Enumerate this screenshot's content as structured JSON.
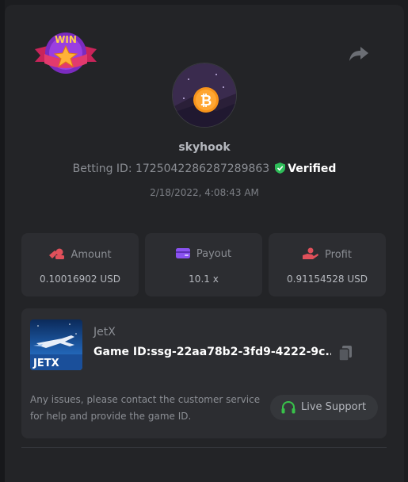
{
  "colors": {
    "page_bg": "#1c1d20",
    "modal_bg": "#232427",
    "card_bg": "#2c2d31",
    "verified_green": "#2ebd59",
    "amount_red": "#e0505a",
    "payout_purple": "#8a52f0",
    "profit_red": "#e0505a",
    "support_green": "#38c24a"
  },
  "badge": {
    "text": "WIN"
  },
  "user": {
    "name": "skyhook",
    "betting_id_label": "Betting ID: 1725042286287289863",
    "verified_label": "Verified",
    "date": "2/18/2022, 4:08:43 AM"
  },
  "stats": [
    {
      "label": "Amount",
      "value": "0.10016902 USD",
      "icon": "coins-icon"
    },
    {
      "label": "Payout",
      "value": "10.1 x",
      "icon": "wallet-icon"
    },
    {
      "label": "Profit",
      "value": "0.91154528 USD",
      "icon": "profit-hand-icon"
    }
  ],
  "game": {
    "name": "JetX",
    "thumb_label": "JETX",
    "id_label": "Game ID:ssg-22aa78b2-3fd9-4222-9c...",
    "note": "Any issues, please contact the customer service for help and provide the game ID.",
    "support_label": "Live Support"
  }
}
